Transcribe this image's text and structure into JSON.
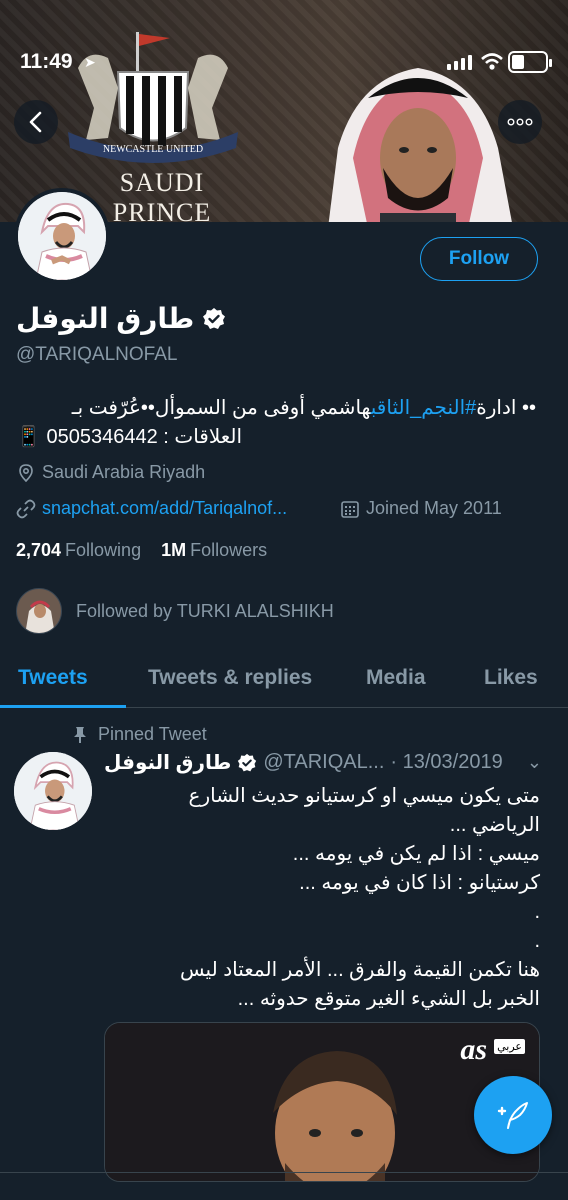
{
  "colors": {
    "background": "#15202b",
    "accent": "#1da1f2",
    "muted": "#8899a6",
    "divider": "#38444d"
  },
  "status_bar": {
    "time": "11:49"
  },
  "banner": {
    "caption": "SAUDI PRINCE",
    "crest_text": "NEWCASTLE UNITED"
  },
  "header_buttons": {
    "back_icon": "chevron-left-icon",
    "more_icon": "more-icon"
  },
  "profile": {
    "follow_label": "Follow",
    "name": "طارق النوفل",
    "handle": "@TARIQALNOFAL",
    "bio_line1_prefix": "هاشمي أوفى من السموأل••عُرّفت بـ ",
    "bio_hashtag": "#النجم_الثاقب",
    "bio_line1_suffix": " •• ادارة",
    "bio_line2": "📱 0505346442 : العلاقات",
    "location": "Saudi Arabia Riyadh",
    "link": "snapchat.com/add/Tariqalnof...",
    "joined": "Joined May 2011",
    "following_count": "2,704",
    "following_label": "Following",
    "followers_count": "1M",
    "followers_label": "Followers",
    "followed_by": "Followed by TURKI ALALSHIKH"
  },
  "tabs": [
    {
      "label": "Tweets",
      "active": true
    },
    {
      "label": "Tweets & replies",
      "active": false
    },
    {
      "label": "Media",
      "active": false
    },
    {
      "label": "Likes",
      "active": false
    }
  ],
  "pinned_tweet": {
    "pinned_label": "Pinned Tweet",
    "name": "طارق النوفل",
    "handle": "@TARIQAL...",
    "date": "· 13/03/2019",
    "lines": [
      "متى يكون ميسي او كرستيانو حديث الشارع",
      "الرياضي ...",
      "ميسي :  اذا لم يكن في يومه ...",
      "كرستيانو : اذا كان  في يومه ...",
      ".",
      ".",
      "هنا تكمن القيمة والفرق ... الأمر المعتاد ليس",
      "الخبر بل الشيء الغير متوقع حدوثه ..."
    ],
    "media_logo": "as",
    "media_logo_sub": "عربي"
  },
  "fab_icon": "compose-tweet-icon"
}
